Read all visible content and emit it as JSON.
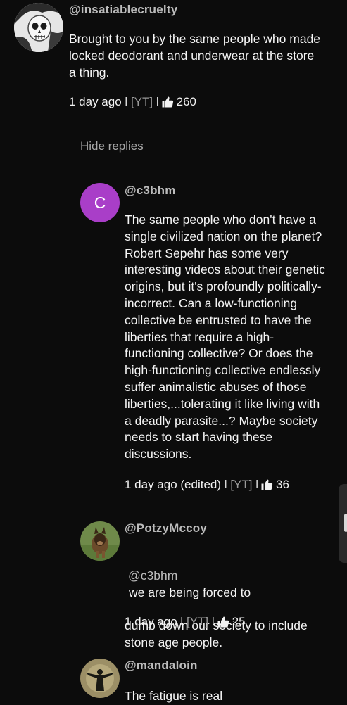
{
  "comments": [
    {
      "handle": "@insatiablecruelty",
      "text": "Brought to you by the same people who made\nlocked deodorant and underwear at the store\na thing.",
      "time": "1 day ago",
      "source": "[YT]",
      "likes": "260"
    }
  ],
  "hide_replies_label": "Hide replies",
  "replies": [
    {
      "handle": "@c3bhm",
      "avatar_letter": "C",
      "avatar_color": "#a93ec8",
      "text": "The same people who don't have a\nsingle civilized nation on the planet?\nRobert Sepehr has some very\ninteresting videos about their genetic\norigins, but it's profoundly politically-\nincorrect.  Can a low-functioning\ncollective be entrusted to have the\nliberties that require a high-\nfunctioning collective?  Or does the\nhigh-functioning collective endlessly\nsuffer animalistic abuses of those\nliberties,...tolerating it like living with\na deadly parasite...?  Maybe society\nneeds to start having these\ndiscussions.",
      "time": "1 day ago (edited)",
      "source": "[YT]",
      "likes": "36"
    },
    {
      "handle": "@PotzyMccoy",
      "mention": "@c3bhm",
      "text_line1": "we are being forced to",
      "text_rest": "dumb down our society to include\nstone age people.",
      "time": "1 day ago",
      "source": "[YT]",
      "likes": "25"
    },
    {
      "handle": "@mandaloin",
      "text": "The fatigue is real"
    }
  ],
  "separator": "l",
  "icons": {
    "like": "thumbs-up-icon"
  },
  "colors": {
    "background": "#0c0c0c",
    "handle": "#bcbcbc",
    "muted": "#9a9a9a"
  }
}
